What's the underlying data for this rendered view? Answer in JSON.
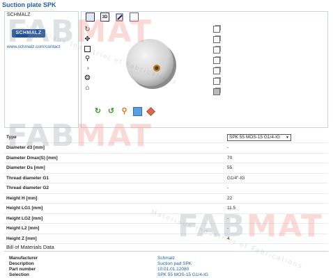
{
  "page": {
    "title": "Suction plate SPK"
  },
  "brand": {
    "name": "SCHMALZ",
    "logo_text": "SCHMALZ",
    "url": "www.schmalz.com/contact"
  },
  "viewer": {
    "toolbar": {
      "three_d_label": "3D"
    },
    "icons": {
      "toolbar": [
        "monitor-icon",
        "3d-icon",
        "draw-icon",
        "page-icon"
      ],
      "side": [
        "rotate-icon",
        "pan-icon",
        "box-icon",
        "zoom-icon",
        "lighting-icon",
        "wheel-icon",
        "home-icon"
      ],
      "views": [
        "view-front-icon",
        "view-back-icon",
        "view-left-icon",
        "view-right-icon",
        "view-top-icon",
        "view-bottom-icon",
        "view-iso-icon"
      ],
      "actions": [
        "refresh-icon",
        "refresh-alt-icon",
        "zoom-fit-icon",
        "screen-icon",
        "diamond-icon"
      ]
    }
  },
  "properties": {
    "type_label": "Type",
    "type_value": "SPK 55 MOS-15 G1/4-IG",
    "rows": [
      {
        "label": "Diameter d3 [mm]",
        "value": "-"
      },
      {
        "label": "Diameter Dmax(S) [mm]",
        "value": "70"
      },
      {
        "label": "Diameter Ds [mm]",
        "value": "55"
      },
      {
        "label": "Thread diameter G1",
        "value": "G1/4\"-IG"
      },
      {
        "label": "Thread diameter G2",
        "value": "-"
      },
      {
        "label": "Height H [mm]",
        "value": "22"
      },
      {
        "label": "Height LG1 [mm]",
        "value": "11.5"
      },
      {
        "label": "Height LG2 [mm]",
        "value": "-"
      },
      {
        "label": "Height L2 [mm]",
        "value": "-"
      },
      {
        "label": "Height Z [mm]",
        "value": "4"
      }
    ]
  },
  "bom": {
    "title": "Bill of Materials Data",
    "rows": [
      {
        "label": "Manufacturer",
        "value": "Schmalz"
      },
      {
        "label": "Description",
        "value": "Suction pad SPK"
      },
      {
        "label": "Part number",
        "value": "10.01.01.12080"
      },
      {
        "label": "Selection",
        "value": "SPK 55 MOS-15 G1/4-IG"
      }
    ]
  },
  "watermark": {
    "logo_a": "FAB",
    "logo_b": "MAT",
    "tagline": "Materiaux Industriel et Fabrications"
  },
  "colors": {
    "accent": "#1f5fa8",
    "brand_blue": "#1d4f9c",
    "refresh_green": "#3a9a2c"
  }
}
